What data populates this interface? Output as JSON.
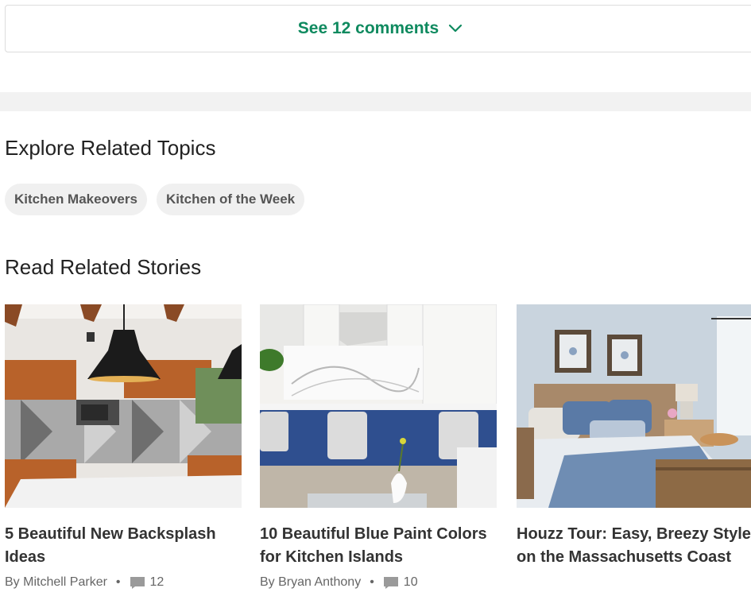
{
  "comments": {
    "label": "See 12 comments"
  },
  "explore": {
    "title": "Explore Related Topics",
    "topics": [
      "Kitchen Makeovers",
      "Kitchen of the Week"
    ]
  },
  "related": {
    "title": "Read Related Stories",
    "stories": [
      {
        "title": "5 Beautiful New Backsplash Ideas",
        "author": "By Mitchell Parker",
        "comments": "12"
      },
      {
        "title": "10 Beautiful Blue Paint Colors for Kitchen Islands",
        "author": "By Bryan Anthony",
        "comments": "10"
      },
      {
        "title": "Houzz Tour: Easy, Breezy Style on the Massachusetts Coast"
      }
    ]
  },
  "colors": {
    "accent": "#0f8a5f",
    "chip_bg": "#f0f0f0",
    "band": "#f2f2f2"
  }
}
